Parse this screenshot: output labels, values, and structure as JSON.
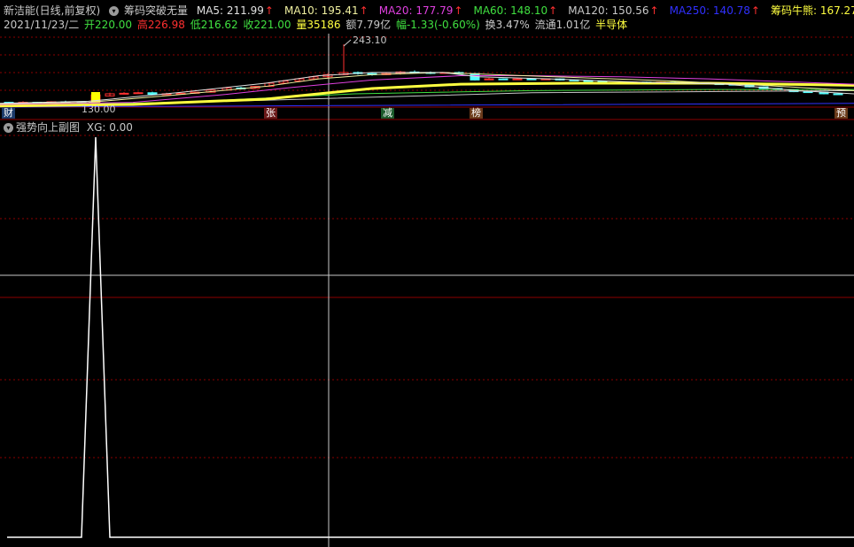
{
  "header": {
    "stock_name": "新洁能(日线,前复权)",
    "indicator_name": "筹码突破无量",
    "ma": [
      {
        "label": "MA5: 211.99",
        "color": "#e0e0e0"
      },
      {
        "label": "MA10: 195.41",
        "color": "#f0f0a0"
      },
      {
        "label": "MA20: 177.79",
        "color": "#e040e0"
      },
      {
        "label": "MA60: 148.10",
        "color": "#40e040"
      },
      {
        "label": "MA120: 150.56",
        "color": "#c8c8c8"
      },
      {
        "label": "MA250: 140.78",
        "color": "#3030ff"
      },
      {
        "label": "筹码牛熊: 167.27",
        "color": "#ffff40"
      }
    ],
    "arrow": "↑"
  },
  "info": {
    "date": "2021/11/23/二",
    "open": "开220.00",
    "high": "高226.98",
    "low": "低216.62",
    "close": "收221.00",
    "volume": "量35186",
    "amount": "额7.79亿",
    "change": "幅-1.33(-0.60%)",
    "turnover": "换3.47%",
    "float": "流通1.01亿",
    "sector": "半导体"
  },
  "chart_data": {
    "type": "line",
    "high_label": "243.10",
    "low_label": "130.00",
    "markers": [
      {
        "text": "财",
        "bg": "#1a3a6a"
      },
      {
        "text": "张",
        "bg": "#6a1a1a"
      },
      {
        "text": "减",
        "bg": "#1a5a2a"
      },
      {
        "text": "榜",
        "bg": "#6a3a1a"
      },
      {
        "text": "预",
        "bg": "#6a3a1a"
      }
    ],
    "subplot": {
      "title": "强势向上副图",
      "value_label": "XG: 0.00",
      "ylim": [
        0,
        1
      ]
    }
  },
  "colors": {
    "grid": "#8b0000",
    "crosshair": "#c8c8c8",
    "up": "#ff3030",
    "down": "#54ffff"
  }
}
